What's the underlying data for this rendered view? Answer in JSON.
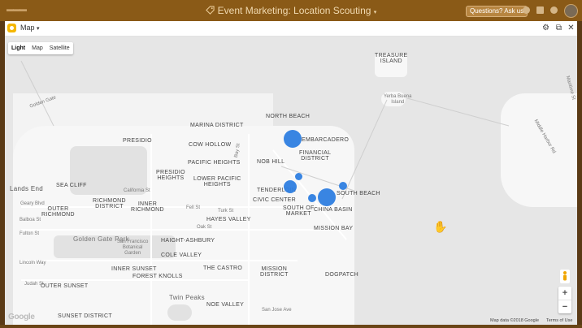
{
  "app": {
    "title": "Event Marketing: Location Scouting",
    "ask_button": "Questions? Ask us",
    "accent": "#8a5a17"
  },
  "panel": {
    "name": "Map",
    "badge_color": "#f5b700",
    "icons": [
      "gear-icon",
      "external-link-icon",
      "close-icon"
    ]
  },
  "map": {
    "type_options": [
      "Light",
      "Map",
      "Satellite"
    ],
    "selected_type": "Light",
    "zoom_in": "+",
    "zoom_out": "−",
    "attribution": "Map data ©2018 Google",
    "terms": "Terms of Use",
    "google_logo": "Google",
    "pin_color": "#2e7ee0",
    "labels": {
      "treasure_island": "TREASURE\nISLAND",
      "yerba_buena": "Yerba Buena\nIsland",
      "golden_gate": "Golden Gate",
      "north_beach": "NORTH BEACH",
      "marina": "MARINA DISTRICT",
      "embarcadero": "EMBARCADERO",
      "presidio": "PRESIDIO",
      "cow_hollow": "COW HOLLOW",
      "financial": "FINANCIAL\nDISTRICT",
      "nob_hill": "NOB HILL",
      "pacific_heights": "PACIFIC HEIGHTS",
      "presidio_heights": "PRESIDIO\nHEIGHTS",
      "lower_pacific": "LOWER PACIFIC\nHEIGHTS",
      "tenderloin": "TENDERLOIN",
      "lands_end": "Lands End",
      "sea_cliff": "SEA CLIFF",
      "richmond_district": "RICHMOND\nDISTRICT",
      "inner_richmond": "INNER\nRICHMOND",
      "civic_center": "CIVIC CENTER",
      "south_beach": "SOUTH BEACH",
      "south_market": "SOUTH OF\nMARKET",
      "china_basin": "CHINA BASIN",
      "outer_richmond": "OUTER\nRICHMOND",
      "hayes_valley": "HAYES VALLEY",
      "mission_bay": "MISSION BAY",
      "gg_park": "Golden Gate Park",
      "sf_botanical": "San Francisco\nBotanical\nGarden",
      "haight": "HAIGHT-ASHBURY",
      "cole_valley": "COLE VALLEY",
      "inner_sunset": "INNER SUNSET",
      "castro": "THE CASTRO",
      "mission": "MISSION\nDISTRICT",
      "dogpatch": "DOGPATCH",
      "outer_sunset": "OUTER SUNSET",
      "forest_knolls": "FOREST KNOLLS",
      "twin_peaks": "Twin Peaks",
      "noe_valley": "NOE VALLEY",
      "sunset_district": "SUNSET DISTRICT",
      "lincoln_way": "Lincoln Way",
      "fulton_st": "Fulton St",
      "balboa_st": "Balboa St",
      "geary": "Geary Blvd",
      "turk": "Turk St",
      "fell": "Fell St",
      "california": "California St",
      "bay_st": "Bay St",
      "judah": "Judah St",
      "san_jose": "San Jose Ave",
      "middle_harbor": "Middle Harbor Rd",
      "maritime": "Maritime St",
      "oak_st": "Oak St"
    }
  }
}
